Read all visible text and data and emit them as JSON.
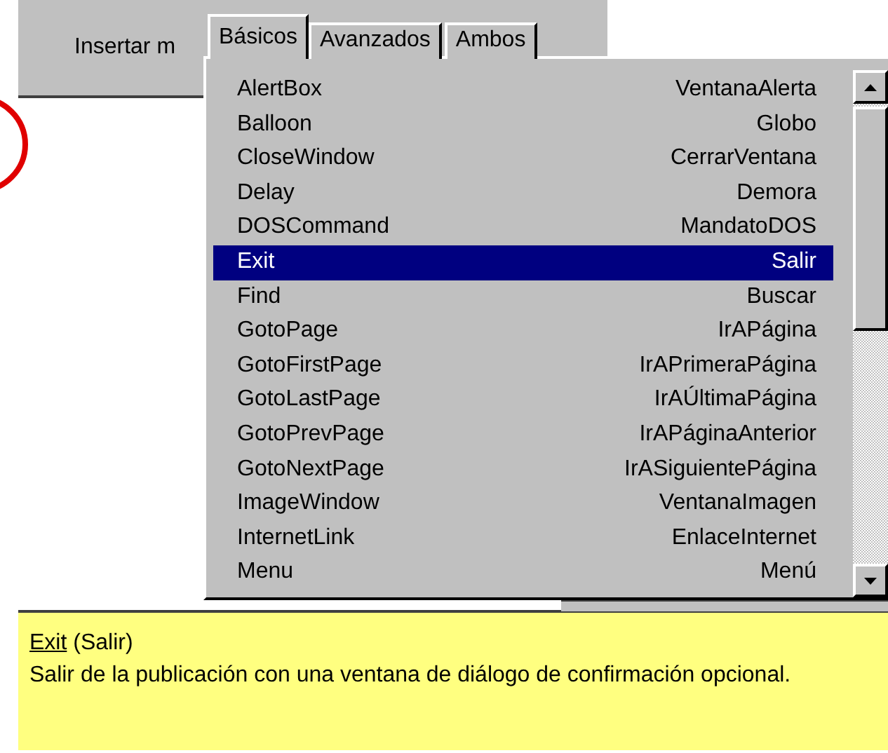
{
  "toolbar": {
    "label": "Insertar m"
  },
  "tabs": [
    {
      "label": "Básicos",
      "selected": true
    },
    {
      "label": "Avanzados",
      "selected": false
    },
    {
      "label": "Ambos",
      "selected": false
    }
  ],
  "commands": [
    {
      "name": "AlertBox",
      "translation": "VentanaAlerta",
      "selected": false
    },
    {
      "name": "Balloon",
      "translation": "Globo",
      "selected": false
    },
    {
      "name": "CloseWindow",
      "translation": "CerrarVentana",
      "selected": false
    },
    {
      "name": "Delay",
      "translation": "Demora",
      "selected": false
    },
    {
      "name": "DOSCommand",
      "translation": "MandatoDOS",
      "selected": false
    },
    {
      "name": "Exit",
      "translation": "Salir",
      "selected": true
    },
    {
      "name": "Find",
      "translation": "Buscar",
      "selected": false
    },
    {
      "name": "GotoPage",
      "translation": "IrAPágina",
      "selected": false
    },
    {
      "name": "GotoFirstPage",
      "translation": "IrAPrimeraPágina",
      "selected": false
    },
    {
      "name": "GotoLastPage",
      "translation": "IrAÚltimaPágina",
      "selected": false
    },
    {
      "name": "GotoPrevPage",
      "translation": "IrAPáginaAnterior",
      "selected": false
    },
    {
      "name": "GotoNextPage",
      "translation": "IrASiguientePágina",
      "selected": false
    },
    {
      "name": "ImageWindow",
      "translation": "VentanaImagen",
      "selected": false
    },
    {
      "name": "InternetLink",
      "translation": "EnlaceInternet",
      "selected": false
    },
    {
      "name": "Menu",
      "translation": "Menú",
      "selected": false
    }
  ],
  "help": {
    "link": "Exit",
    "title": "(Salir)",
    "text": "Salir de la publicación con una ventana de diálogo de confirmación opcional."
  }
}
